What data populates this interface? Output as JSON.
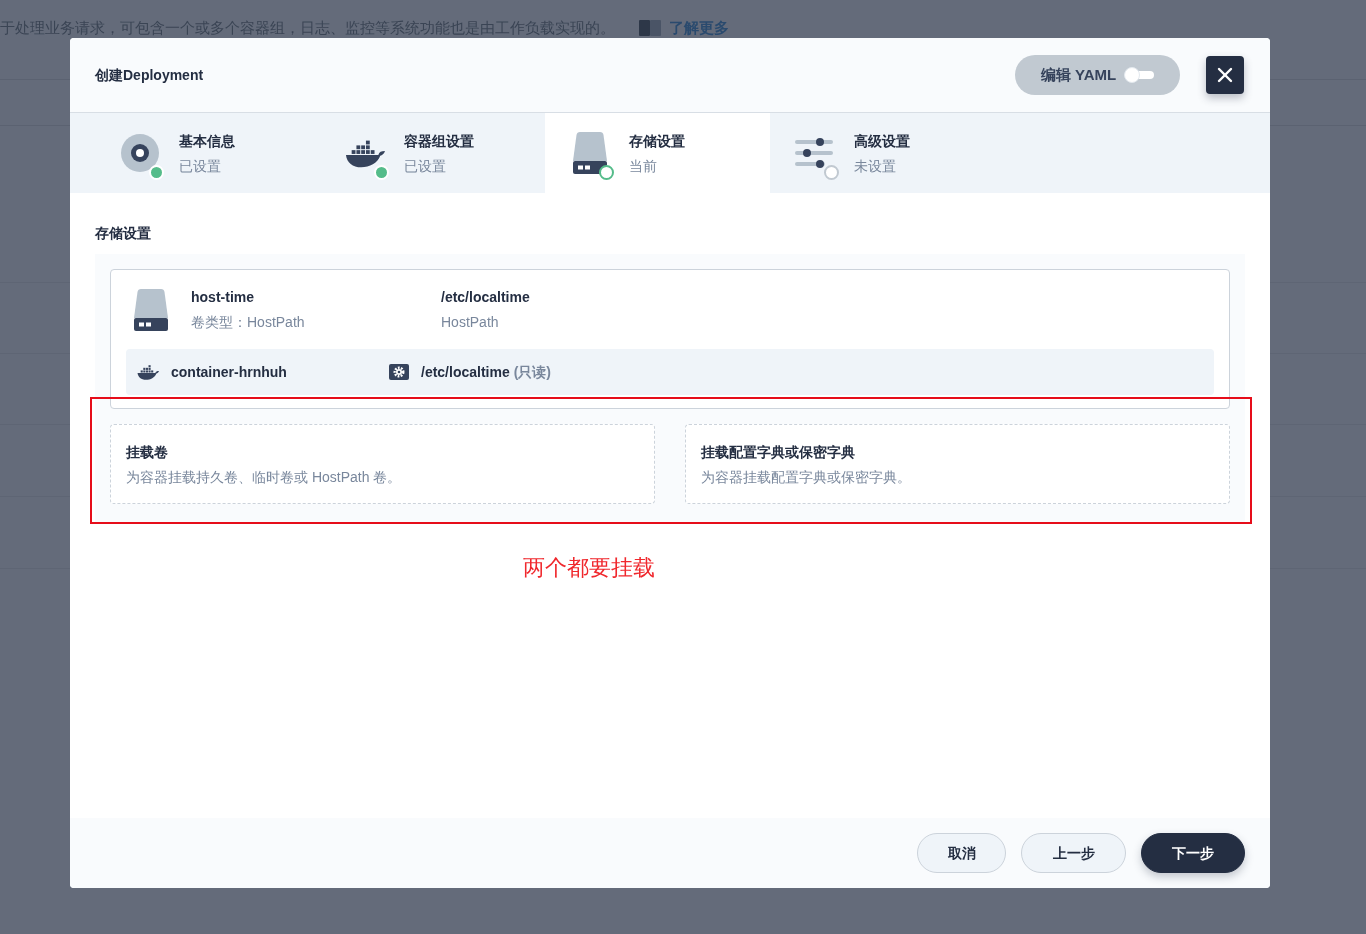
{
  "background_page": {
    "description": "于处理业务请求，可包含一个或多个容器组，日志、监控等系统功能也是由工作负载实现的。",
    "link": "了解更多"
  },
  "dialog": {
    "title": "创建Deployment",
    "yaml_button": {
      "label": "编辑 YAML",
      "on": false
    }
  },
  "steps": [
    {
      "title": "基本信息",
      "status": "已设置",
      "completed": true,
      "selected": false
    },
    {
      "title": "容器组设置",
      "status": "已设置",
      "completed": true,
      "selected": false
    },
    {
      "title": "存储设置",
      "status": "当前",
      "completed": false,
      "selected": true
    },
    {
      "title": "高级设置",
      "status": "未设置",
      "completed": false,
      "selected": false
    }
  ],
  "section_title": "存储设置",
  "volumes": [
    {
      "name": "host-time",
      "type": "卷类型：HostPath",
      "path": "/etc/localtime",
      "path_type": "HostPath",
      "mounts": [
        {
          "container": "container-hrnhuh",
          "path": "/etc/localtime",
          "mode": "(只读)"
        }
      ]
    }
  ],
  "mount_options": [
    {
      "title": "挂载卷",
      "description": "为容器挂载持久卷、临时卷或 HostPath 卷。"
    },
    {
      "title": "挂载配置字典或保密字典",
      "description": "为容器挂载配置字典或保密字典。"
    }
  ],
  "annotation": "两个都要挂载",
  "footer_buttons": [
    {
      "label": "取消",
      "kind": "secondary"
    },
    {
      "label": "上一步",
      "kind": "secondary"
    },
    {
      "label": "下一步",
      "kind": "primary"
    }
  ]
}
